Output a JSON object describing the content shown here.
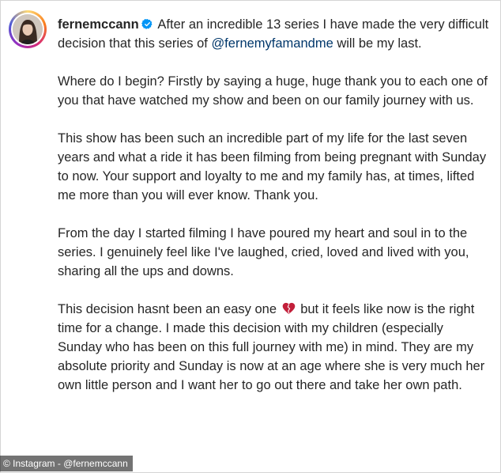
{
  "post": {
    "username": "fernemccann",
    "first_line_text": " After an incredible 13 series I have made the very difficult decision that this series of ",
    "mention": "@fernemyfamandme",
    "first_line_end": " will be my last.",
    "paragraphs": [
      "Where do I begin? Firstly by saying a huge, huge thank you to each one of you that have watched my show and been on our family journey with us.",
      "This show has been such an incredible part of my life for the last seven years and what a ride it has been filming from being pregnant with Sunday to now. Your support and loyalty to me and my family has, at times, lifted me more than you will ever know. Thank you.",
      "From the day I started filming I have poured my heart and soul in to the series. I genuinely feel like I've laughed, cried, loved and lived with you, sharing all the ups and downs."
    ],
    "last_para_before": "This decision hasnt been an easy one ",
    "last_para_after": " but it feels like now is the right time for a change. I made this decision with my children (especially Sunday who has been on this full journey with me) in mind. They are my absolute priority and Sunday is now at an age where she is very much her own little person and I want her to go out there and take her own path."
  },
  "icons": {
    "verified": "verified-badge-icon",
    "heart": "broken-heart-icon"
  },
  "colors": {
    "text": "#262626",
    "mention": "#00376b",
    "verified": "#0095f6",
    "heart": "#c21f3a"
  },
  "credit": {
    "text": "© Instagram - @fernemccann"
  }
}
